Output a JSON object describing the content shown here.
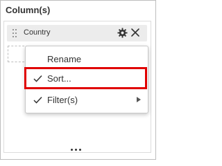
{
  "panel": {
    "title": "Column(s)"
  },
  "field": {
    "label": "Country",
    "settings_icon": "gear-icon",
    "remove_icon": "close-icon"
  },
  "menu": {
    "items": [
      {
        "label": "Rename",
        "checked": false,
        "has_submenu": false
      },
      {
        "label": "Sort...",
        "checked": true,
        "has_submenu": false,
        "highlighted": true
      },
      {
        "label": "Filter(s)",
        "checked": true,
        "has_submenu": true
      }
    ]
  },
  "colors": {
    "highlight": "#e00000",
    "chip_background": "#ececec",
    "text": "#333333"
  },
  "footer": {
    "more_icon": "more-horizontal-icon"
  }
}
